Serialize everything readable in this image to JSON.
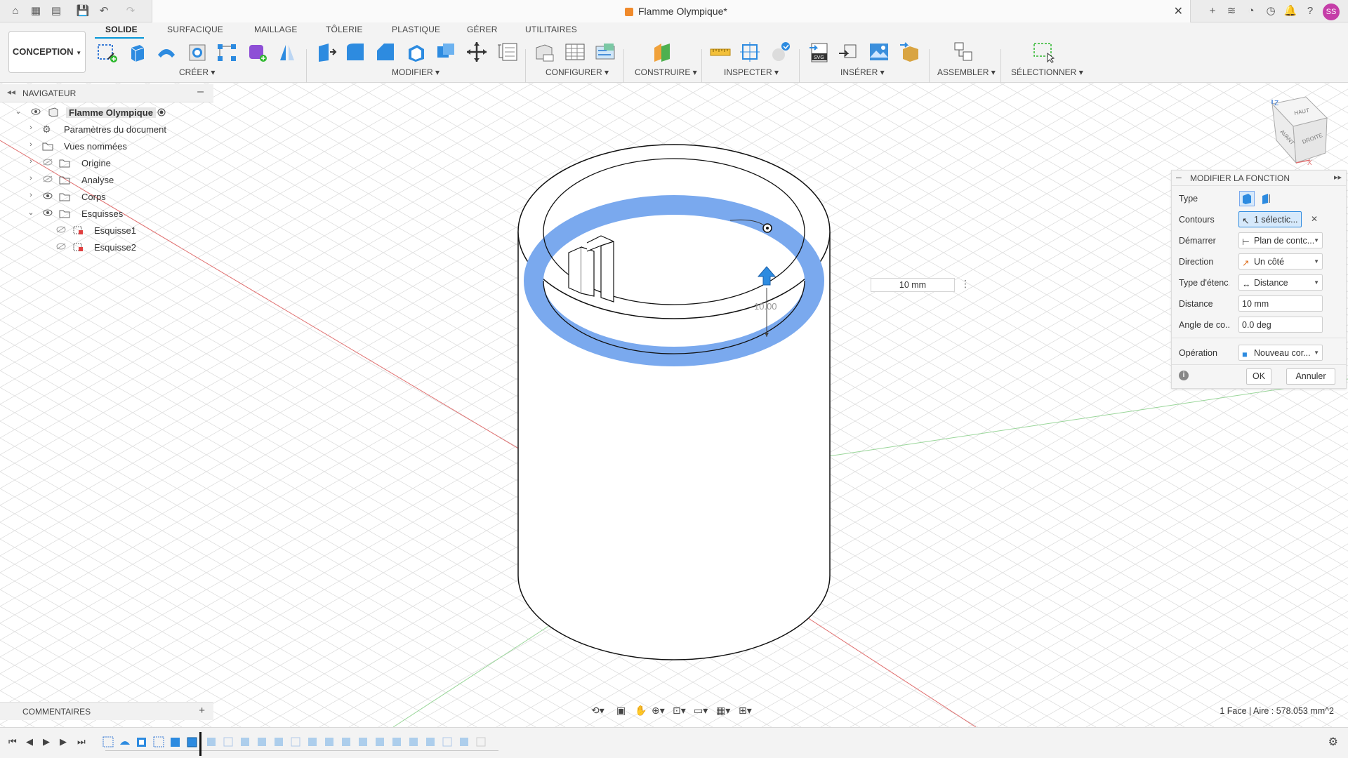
{
  "titlebar": {
    "doc_title": "Flamme Olympique*",
    "avatar_initials": "SS"
  },
  "ribbon": {
    "workspace": "CONCEPTION",
    "tabs": [
      "SOLIDE",
      "SURFACIQUE",
      "MAILLAGE",
      "TÔLERIE",
      "PLASTIQUE",
      "GÉRER",
      "UTILITAIRES"
    ],
    "active_tab": "SOLIDE",
    "groups": [
      "CRÉER",
      "MODIFIER",
      "CONFIGURER",
      "CONSTRUIRE",
      "INSPECTER",
      "INSÉRER",
      "ASSEMBLER",
      "SÉLECTIONNER"
    ],
    "accent_color": "#0696d7"
  },
  "navigator": {
    "title": "NAVIGATEUR",
    "items": [
      {
        "label": "Flamme Olympique",
        "kind": "component"
      },
      {
        "label": "Paramètres du document",
        "kind": "gear"
      },
      {
        "label": "Vues nommées",
        "kind": "folder"
      },
      {
        "label": "Origine",
        "kind": "folder"
      },
      {
        "label": "Analyse",
        "kind": "folder"
      },
      {
        "label": "Corps",
        "kind": "folder"
      },
      {
        "label": "Esquisses",
        "kind": "folder"
      },
      {
        "label": "Esquisse1",
        "kind": "sketch"
      },
      {
        "label": "Esquisse2",
        "kind": "sketch"
      }
    ]
  },
  "viewcube": {
    "top": "HAUT",
    "front": "AVANT",
    "right": "DROITE",
    "axis_z": "Z",
    "axis_x": "X"
  },
  "viewport": {
    "dimension_value": "10 mm",
    "dimension_label": "10.00",
    "selection_color": "#7aa9ee"
  },
  "panel": {
    "title": "MODIFIER LA FONCTION",
    "rows": {
      "type": "Type",
      "contours": "Contours",
      "contours_value": "1 sélectic...",
      "demarrer": "Démarrer",
      "demarrer_value": "Plan de contc...",
      "direction": "Direction",
      "direction_value": "Un côté",
      "type_etendue": "Type d'étenc...",
      "type_etendue_value": "Distance",
      "distance": "Distance",
      "distance_value": "10 mm",
      "angle": "Angle de co...",
      "angle_value": "0.0 deg",
      "operation": "Opération",
      "operation_value": "Nouveau cor..."
    },
    "ok": "OK",
    "cancel": "Annuler"
  },
  "comments": {
    "title": "COMMENTAIRES"
  },
  "status": {
    "selection": "1 Face | Aire : 578.053 mm^2"
  }
}
